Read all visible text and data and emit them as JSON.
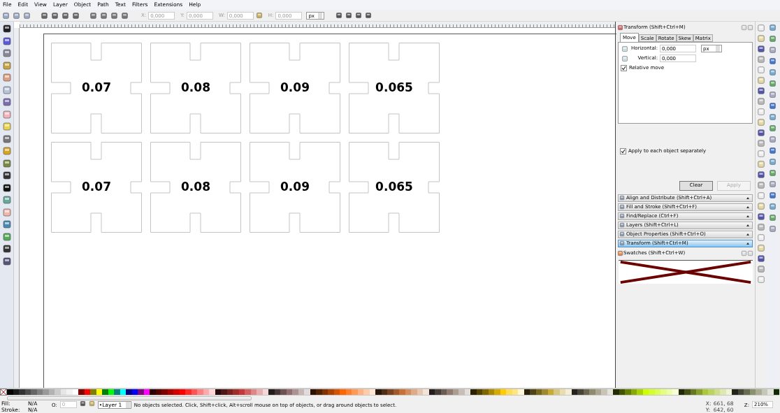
{
  "menu": [
    "File",
    "Edit",
    "View",
    "Layer",
    "Object",
    "Path",
    "Text",
    "Filters",
    "Extensions",
    "Help"
  ],
  "toolbar": {
    "fields": [
      {
        "label": "X:",
        "value": "0,000",
        "disabled": true
      },
      {
        "label": "Y:",
        "value": "0,000",
        "disabled": true
      },
      {
        "label": "W:",
        "value": "0,000",
        "disabled": true
      },
      {
        "label": "H:",
        "value": "0,000",
        "disabled": true
      }
    ],
    "unit": "px"
  },
  "canvas": {
    "pieces": [
      {
        "label": "0.07"
      },
      {
        "label": "0.08"
      },
      {
        "label": "0.09"
      },
      {
        "label": "0.065"
      },
      {
        "label": "0.07"
      },
      {
        "label": "0.08"
      },
      {
        "label": "0.09"
      },
      {
        "label": "0.065"
      }
    ]
  },
  "transform_dialog": {
    "title": "Transform (Shift+Ctrl+M)",
    "tabs": [
      {
        "label": "Move",
        "selected": true
      },
      {
        "label": "Scale",
        "selected": false
      },
      {
        "label": "Rotate",
        "selected": false
      },
      {
        "label": "Skew",
        "selected": false
      },
      {
        "label": "Matrix",
        "selected": false
      }
    ],
    "horizontal": {
      "label": "Horizontal:",
      "value": "0,000",
      "unit": "px"
    },
    "vertical": {
      "label": "Vertical:",
      "value": "0,000"
    },
    "relative_move": {
      "label": "Relative move",
      "checked": true
    },
    "apply_each": {
      "label": "Apply to each object separately",
      "checked": true
    },
    "buttons": [
      {
        "label": "Clear",
        "disabled": false
      },
      {
        "label": "Apply",
        "disabled": true
      }
    ]
  },
  "docked_dialogs": [
    {
      "label": "Align and Distribute (Shift+Ctrl+A)",
      "selected": false
    },
    {
      "label": "Fill and Stroke (Shift+Ctrl+F)",
      "selected": false
    },
    {
      "label": "Find/Replace (Ctrl+F)",
      "selected": false
    },
    {
      "label": "Layers (Shift+Ctrl+L)",
      "selected": false
    },
    {
      "label": "Object Properties (Shift+Ctrl+O)",
      "selected": false
    },
    {
      "label": "Transform (Shift+Ctrl+M)",
      "selected": true
    }
  ],
  "swatches": {
    "title": "Swatches (Shift+Ctrl+W)"
  },
  "palette": [
    {
      "color": "#000000"
    },
    {
      "color": "#1a1a1a"
    },
    {
      "color": "#333333"
    },
    {
      "color": "#4d4d4d"
    },
    {
      "color": "#666666"
    },
    {
      "color": "#808080"
    },
    {
      "color": "#999999"
    },
    {
      "color": "#b3b3b3"
    },
    {
      "color": "#cccccc"
    },
    {
      "color": "#e6e6e6"
    },
    {
      "color": "#f2f2f2"
    },
    {
      "color": "#ffffff"
    },
    {
      "color": "#800000"
    },
    {
      "color": "#ff0000"
    },
    {
      "color": "#808000"
    },
    {
      "color": "#ffff00"
    },
    {
      "color": "#008000"
    },
    {
      "color": "#00ff00"
    },
    {
      "color": "#008080"
    },
    {
      "color": "#00ffff"
    },
    {
      "color": "#000080"
    },
    {
      "color": "#0000ff"
    },
    {
      "color": "#800080"
    },
    {
      "color": "#ff00ff"
    },
    {
      "color": "#2b0000"
    },
    {
      "color": "#550000"
    },
    {
      "color": "#800000"
    },
    {
      "color": "#aa0000"
    },
    {
      "color": "#d40000"
    },
    {
      "color": "#ff0000"
    },
    {
      "color": "#ff2a2a"
    },
    {
      "color": "#ff5555"
    },
    {
      "color": "#ff8080"
    },
    {
      "color": "#ffaaaa"
    },
    {
      "color": "#ffd5d5"
    },
    {
      "color": "#280b0b"
    },
    {
      "color": "#501616"
    },
    {
      "color": "#782121"
    },
    {
      "color": "#a02c2c"
    },
    {
      "color": "#c83737"
    },
    {
      "color": "#d35f5f"
    },
    {
      "color": "#de8787"
    },
    {
      "color": "#e9afaf"
    },
    {
      "color": "#f4d7d7"
    },
    {
      "color": "#241c1c"
    },
    {
      "color": "#483737"
    },
    {
      "color": "#6c5353"
    },
    {
      "color": "#916f6f"
    },
    {
      "color": "#ac9393"
    },
    {
      "color": "#c8b7b7"
    },
    {
      "color": "#e3dbdb"
    },
    {
      "color": "#2b1100"
    },
    {
      "color": "#552200"
    },
    {
      "color": "#803300"
    },
    {
      "color": "#aa4400"
    },
    {
      "color": "#d45500"
    },
    {
      "color": "#ff6600"
    },
    {
      "color": "#ff7f2a"
    },
    {
      "color": "#ff9955"
    },
    {
      "color": "#ffb380"
    },
    {
      "color": "#ffccaa"
    },
    {
      "color": "#ffe6d5"
    },
    {
      "color": "#28170b"
    },
    {
      "color": "#502d16"
    },
    {
      "color": "#784421"
    },
    {
      "color": "#a05a2c"
    },
    {
      "color": "#c87137"
    },
    {
      "color": "#d38d5f"
    },
    {
      "color": "#deaa87"
    },
    {
      "color": "#e9c6af"
    },
    {
      "color": "#f4e3d7"
    },
    {
      "color": "#241f1c"
    },
    {
      "color": "#483e37"
    },
    {
      "color": "#6c5d53"
    },
    {
      "color": "#917c6f"
    },
    {
      "color": "#ac9d93"
    },
    {
      "color": "#c8beb7"
    },
    {
      "color": "#e3dedb"
    },
    {
      "color": "#2b2200"
    },
    {
      "color": "#554400"
    },
    {
      "color": "#806600"
    },
    {
      "color": "#aa8800"
    },
    {
      "color": "#d4aa00"
    },
    {
      "color": "#ffcc00"
    },
    {
      "color": "#ffdd55"
    },
    {
      "color": "#ffe680"
    },
    {
      "color": "#fff6d5"
    },
    {
      "color": "#28220b"
    },
    {
      "color": "#504416"
    },
    {
      "color": "#786721"
    },
    {
      "color": "#a0892c"
    },
    {
      "color": "#c8ab37"
    },
    {
      "color": "#d4c87f"
    },
    {
      "color": "#e9ddaf"
    },
    {
      "color": "#f4eed7"
    },
    {
      "color": "#24221c"
    },
    {
      "color": "#484537"
    },
    {
      "color": "#6c6753"
    },
    {
      "color": "#918a6f"
    },
    {
      "color": "#aca793"
    },
    {
      "color": "#c8c4b7"
    },
    {
      "color": "#e3e2db"
    },
    {
      "color": "#222b00"
    },
    {
      "color": "#445500"
    },
    {
      "color": "#668000"
    },
    {
      "color": "#88aa00"
    },
    {
      "color": "#aad400"
    },
    {
      "color": "#ccff00"
    },
    {
      "color": "#d4ff2a"
    },
    {
      "color": "#ddff55"
    },
    {
      "color": "#e5ff80"
    },
    {
      "color": "#eeffaa"
    },
    {
      "color": "#f6ffd5"
    },
    {
      "color": "#22280b"
    },
    {
      "color": "#445016"
    },
    {
      "color": "#677821"
    },
    {
      "color": "#89a02c"
    },
    {
      "color": "#abc837"
    },
    {
      "color": "#bcd35f"
    },
    {
      "color": "#cdde87"
    },
    {
      "color": "#dde9af"
    },
    {
      "color": "#eef4d7"
    },
    {
      "color": "#22241c"
    },
    {
      "color": "#444837"
    },
    {
      "color": "#676c53"
    },
    {
      "color": "#89916f"
    },
    {
      "color": "#abac93"
    },
    {
      "color": "#c4c8b7"
    },
    {
      "color": "#e2e3db"
    },
    {
      "color": "#112b00"
    }
  ],
  "status": {
    "fill_label": "Fill:",
    "fill_value": "N/A",
    "stroke_label": "Stroke:",
    "stroke_value": "N/A",
    "opacity_label": "O:",
    "opacity_value": "0",
    "layer": "•Layer 1",
    "message": "No objects selected. Click, Shift+click, Alt+scroll mouse on top of objects, or drag around objects to select.",
    "x_label": "X:",
    "x_value": "661, 68",
    "y_label": "Y:",
    "y_value": "642, 60",
    "zoom_label": "Z:",
    "zoom_value": "210%"
  }
}
